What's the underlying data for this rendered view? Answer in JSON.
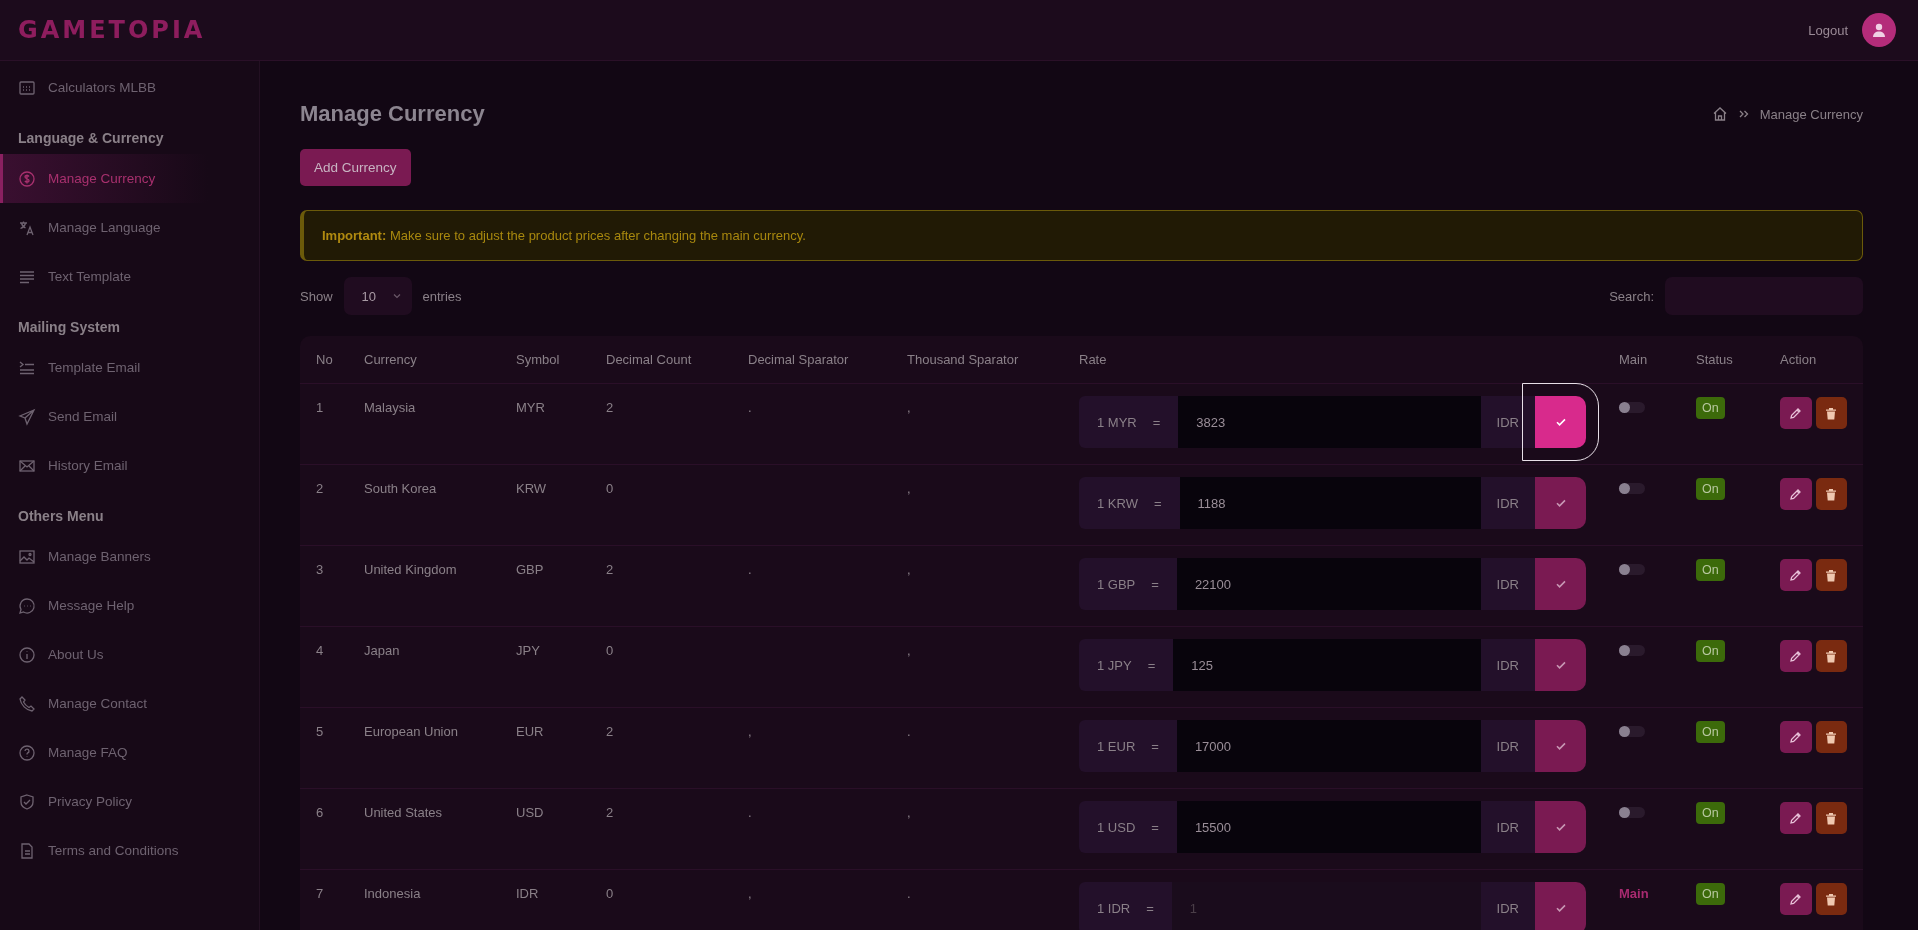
{
  "header": {
    "logo": "GAMETOPIA",
    "logout": "Logout"
  },
  "sidebar": {
    "sections": [
      {
        "items": [
          {
            "label": "Calculators MLBB",
            "selected": false
          }
        ]
      },
      {
        "title": "Language & Currency",
        "items": [
          {
            "label": "Manage Currency",
            "selected": true
          },
          {
            "label": "Manage Language",
            "selected": false
          },
          {
            "label": "Text Template",
            "selected": false
          }
        ]
      },
      {
        "title": "Mailing System",
        "items": [
          {
            "label": "Template Email",
            "selected": false
          },
          {
            "label": "Send Email",
            "selected": false
          },
          {
            "label": "History Email",
            "selected": false
          }
        ]
      },
      {
        "title": "Others Menu",
        "items": [
          {
            "label": "Manage Banners",
            "selected": false
          },
          {
            "label": "Message Help",
            "selected": false
          },
          {
            "label": "About Us",
            "selected": false
          },
          {
            "label": "Manage Contact",
            "selected": false
          },
          {
            "label": "Manage FAQ",
            "selected": false
          },
          {
            "label": "Privacy Policy",
            "selected": false
          },
          {
            "label": "Terms and Conditions",
            "selected": false
          }
        ]
      }
    ]
  },
  "page": {
    "title": "Manage Currency",
    "breadcrumb": "Manage Currency",
    "add_button": "Add Currency"
  },
  "alert": {
    "text": "**Important:** Make sure to adjust the product prices after changing the main currency."
  },
  "controls": {
    "show": "Show",
    "entries_value": "10",
    "entries": "entries",
    "search": "Search:"
  },
  "table": {
    "columns": [
      "No",
      "Currency",
      "Symbol",
      "Decimal Count",
      "Decimal Sparator",
      "Thousand Sparator",
      "Rate",
      "Main",
      "Status",
      "Action"
    ],
    "rows": [
      {
        "no": "1",
        "currency": "Malaysia",
        "symbol": "MYR",
        "decimal_count": "2",
        "decimal_sep": ".",
        "thousand_sep": ",",
        "rate_prefix": "1 MYR",
        "rate_eq": "=",
        "rate": "3823",
        "rate_disabled": false,
        "rate_suffix": "IDR",
        "save_focused": true,
        "main": {
          "kind": "toggle",
          "on": false
        },
        "status": "On"
      },
      {
        "no": "2",
        "currency": "South Korea",
        "symbol": "KRW",
        "decimal_count": "0",
        "thousand_sep": ",",
        "rate_prefix": "1 KRW",
        "rate_eq": "=",
        "rate": "1188",
        "rate_disabled": false,
        "rate_suffix": "IDR",
        "save_focused": false,
        "main": {
          "kind": "toggle",
          "on": false
        },
        "status": "On"
      },
      {
        "no": "3",
        "currency": "United Kingdom",
        "symbol": "GBP",
        "decimal_count": "2",
        "decimal_sep": ".",
        "thousand_sep": ",",
        "rate_prefix": "1 GBP",
        "rate_eq": "=",
        "rate": "22100",
        "rate_disabled": false,
        "rate_suffix": "IDR",
        "save_focused": false,
        "main": {
          "kind": "toggle",
          "on": false
        },
        "status": "On"
      },
      {
        "no": "4",
        "currency": "Japan",
        "symbol": "JPY",
        "decimal_count": "0",
        "thousand_sep": ",",
        "rate_prefix": "1 JPY",
        "rate_eq": "=",
        "rate": "125",
        "rate_disabled": false,
        "rate_suffix": "IDR",
        "save_focused": false,
        "main": {
          "kind": "toggle",
          "on": false
        },
        "status": "On"
      },
      {
        "no": "5",
        "currency": "European Union",
        "symbol": "EUR",
        "decimal_count": "2",
        "decimal_sep": ",",
        "thousand_sep": ".",
        "rate_prefix": "1 EUR",
        "rate_eq": "=",
        "rate": "17000",
        "rate_disabled": false,
        "rate_suffix": "IDR",
        "save_focused": false,
        "main": {
          "kind": "toggle",
          "on": false
        },
        "status": "On"
      },
      {
        "no": "6",
        "currency": "United States",
        "symbol": "USD",
        "decimal_count": "2",
        "decimal_sep": ".",
        "thousand_sep": ",",
        "rate_prefix": "1 USD",
        "rate_eq": "=",
        "rate": "15500",
        "rate_disabled": false,
        "rate_suffix": "IDR",
        "save_focused": false,
        "main": {
          "kind": "toggle",
          "on": false
        },
        "status": "On"
      },
      {
        "no": "7",
        "currency": "Indonesia",
        "symbol": "IDR",
        "decimal_count": "0",
        "decimal_sep": ",",
        "thousand_sep": ".",
        "rate_prefix": "1 IDR",
        "rate_eq": "=",
        "rate": "1",
        "rate_disabled": true,
        "rate_suffix": "IDR",
        "save_focused": false,
        "main": {
          "kind": "label",
          "text": "Main"
        },
        "status": "On"
      }
    ]
  }
}
